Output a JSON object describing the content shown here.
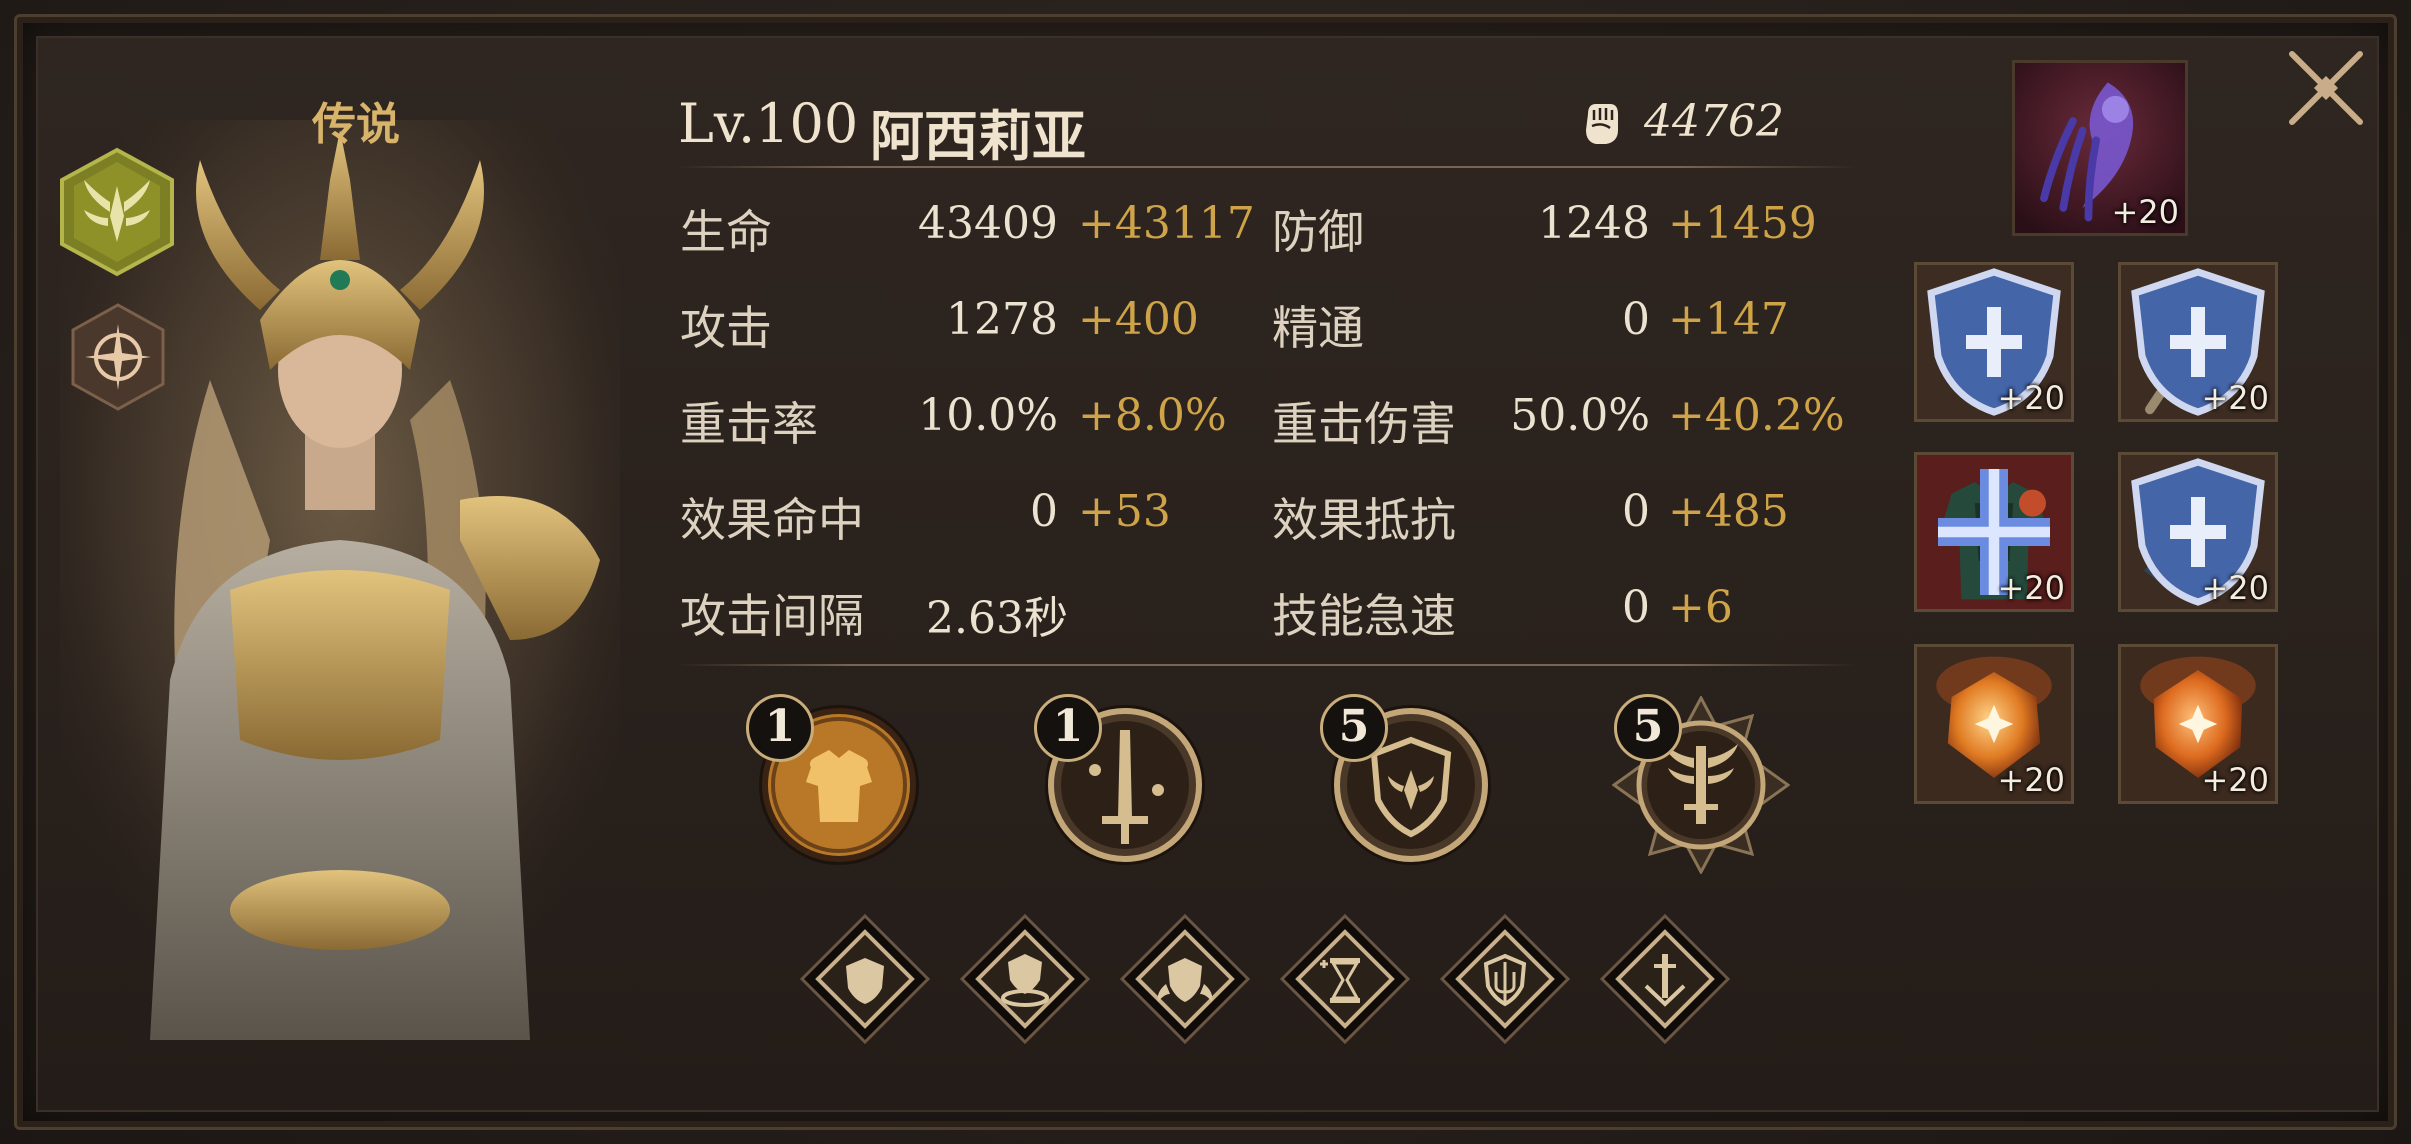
{
  "hero": {
    "rarity": "传说",
    "level": "Lv.100",
    "name": "阿西莉亚",
    "power": "44762"
  },
  "stats": {
    "left": [
      {
        "label": "生命",
        "value": "43409",
        "bonus": "+43117"
      },
      {
        "label": "攻击",
        "value": "1278",
        "bonus": "+400"
      },
      {
        "label": "重击率",
        "value": "10.0%",
        "bonus": "+8.0%"
      },
      {
        "label": "效果命中",
        "value": "0",
        "bonus": "+53"
      },
      {
        "label": "攻击间隔",
        "value": "2.63秒",
        "bonus": ""
      }
    ],
    "right": [
      {
        "label": "防御",
        "value": "1248",
        "bonus": "+1459"
      },
      {
        "label": "精通",
        "value": "0",
        "bonus": "+147"
      },
      {
        "label": "重击伤害",
        "value": "50.0%",
        "bonus": "+40.2%"
      },
      {
        "label": "效果抵抗",
        "value": "0",
        "bonus": "+485"
      },
      {
        "label": "技能急速",
        "value": "0",
        "bonus": "+6"
      }
    ]
  },
  "skills": [
    {
      "level": "1",
      "icon": "armor-skill-icon"
    },
    {
      "level": "1",
      "icon": "sword-skill-icon"
    },
    {
      "level": "5",
      "icon": "shield-skill-icon"
    },
    {
      "level": "5",
      "icon": "winged-sword-skill-icon"
    }
  ],
  "passives": [
    {
      "icon": "shield-passive-icon"
    },
    {
      "icon": "shield-ring-passive-icon"
    },
    {
      "icon": "shield-wings-passive-icon"
    },
    {
      "icon": "hourglass-passive-icon"
    },
    {
      "icon": "shield-trident-passive-icon"
    },
    {
      "icon": "sword-down-passive-icon"
    }
  ],
  "equipment": {
    "artifact": {
      "enhance": "+20",
      "icon": "shadow-artifact-icon"
    },
    "slots": [
      {
        "enhance": "+20",
        "icon": "helmet-icon",
        "badge": "shield-badge-icon"
      },
      {
        "enhance": "+20",
        "icon": "mace-icon",
        "badge": "shield-badge-icon"
      },
      {
        "enhance": "+20",
        "icon": "chest-armor-icon",
        "badge": "plus-badge-icon"
      },
      {
        "enhance": "+20",
        "icon": "gauntlet-icon",
        "badge": "shield-badge-icon"
      },
      {
        "enhance": "+20",
        "icon": "amber-gem-icon",
        "badge": ""
      },
      {
        "enhance": "+20",
        "icon": "amber-gem-icon",
        "badge": ""
      }
    ]
  },
  "colors": {
    "gold": "#cfa348",
    "text": "#ece2d0",
    "frame": "#5b4a35"
  }
}
